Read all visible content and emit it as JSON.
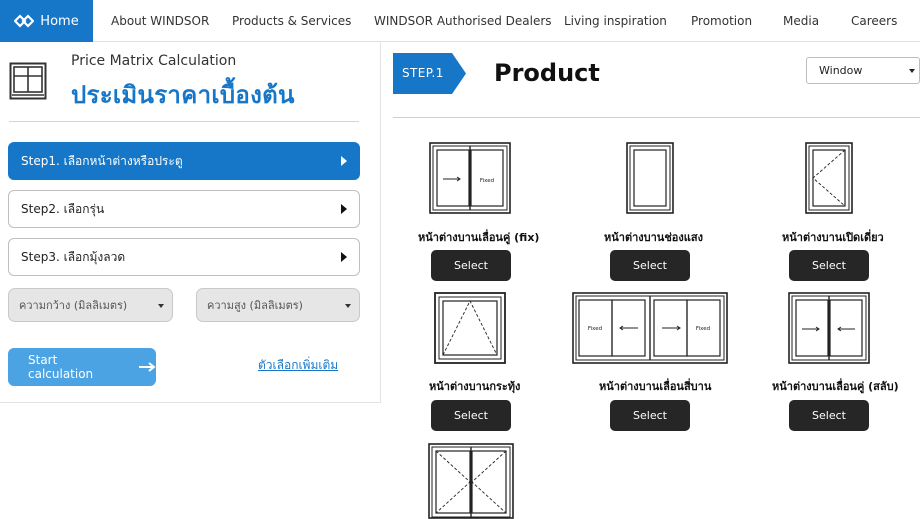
{
  "nav": {
    "home": "Home",
    "items": [
      "About WINDSOR",
      "Products & Services",
      "WINDSOR Authorised Dealers",
      "Living inspiration",
      "Promotion",
      "Media",
      "Careers"
    ]
  },
  "calc": {
    "subtitle": "Price Matrix Calculation",
    "title": "ประเมินราคาเบื้องต้น",
    "steps": [
      "Step1. เลือกหน้าต่างหรือประตู",
      "Step2. เลือกรุ่น",
      "Step3. เลือกมุ้งลวด"
    ],
    "width_placeholder": "ความกว้าง (มิลลิเมตร)",
    "height_placeholder": "ความสูง (มิลลิเมตร)",
    "start_label": "Start calculation",
    "more_options": "ตัวเลือกเพิ่มเติม"
  },
  "product": {
    "step_label": "STEP.1",
    "title": "Product",
    "selected_type": "Window",
    "select_label": "Select",
    "fixed_text": "Fixed",
    "items": [
      "หน้าต่างบานเลื่อนคู่ (fix)",
      "หน้าต่างบานช่องแสง",
      "หน้าต่างบานเปิดเดี่ยว",
      "หน้าต่างบานกระทุ้ง",
      "หน้าต่างบานเลื่อนสี่บาน",
      "หน้าต่างบานเลื่อนคู่ (สลับ)"
    ]
  },
  "colors": {
    "brand_blue": "#1677c9",
    "button_light_blue": "#4ba3e3",
    "select_button": "#262626"
  }
}
